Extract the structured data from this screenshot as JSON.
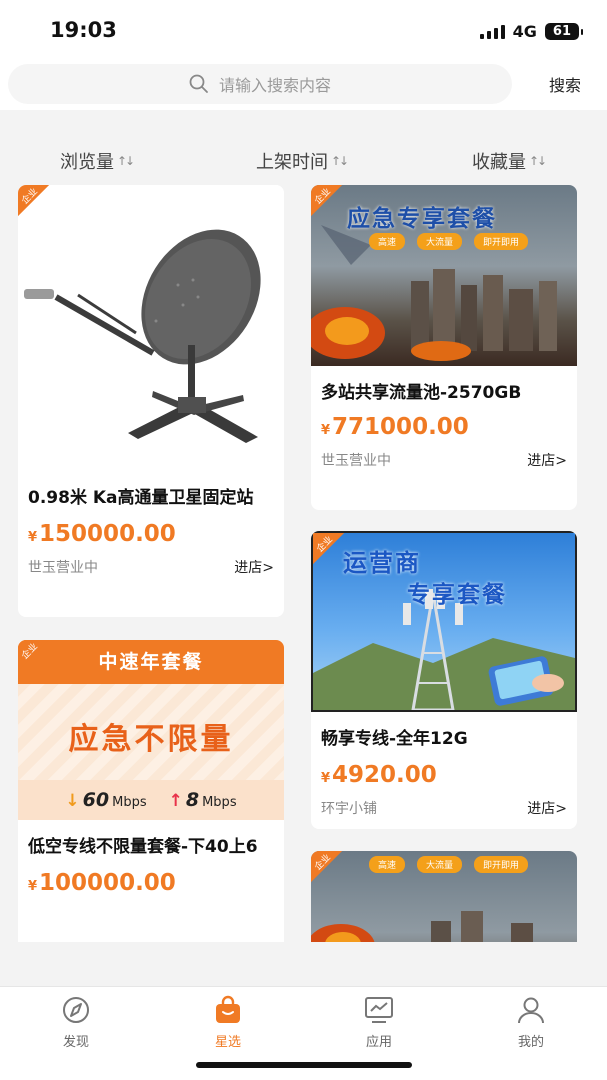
{
  "status": {
    "time": "19:03",
    "network": "4G",
    "battery": "61"
  },
  "search": {
    "placeholder": "请输入搜索内容",
    "button_label": "搜索",
    "icon": "search-icon"
  },
  "sort": [
    {
      "label": "浏览量"
    },
    {
      "label": "上架时间"
    },
    {
      "label": "收藏量"
    }
  ],
  "corner_tag": "企业",
  "products": [
    {
      "title": "0.98米 Ka高通量卫星固定站",
      "currency": "¥",
      "price": "150000.00",
      "shop": "世玉营业中",
      "enter_label": "进店>"
    },
    {
      "title": "多站共享流量池-2570GB",
      "currency": "¥",
      "price": "771000.00",
      "shop": "世玉营业中",
      "enter_label": "进店>",
      "banner": {
        "headline": "应急专享套餐",
        "chips": [
          "高速",
          "大流量",
          "即开即用"
        ]
      }
    },
    {
      "title": "低空专线不限量套餐-下40上6",
      "currency": "¥",
      "price": "100000.00",
      "shop": "",
      "enter_label": "",
      "banner": {
        "header": "中速年套餐",
        "headline": "应急不限量",
        "down_value": "60",
        "up_value": "8",
        "unit": "Mbps"
      }
    },
    {
      "title": "畅享专线-全年12G",
      "currency": "¥",
      "price": "4920.00",
      "shop": "环宇小铺",
      "enter_label": "进店>",
      "banner": {
        "headline_1": "运营商",
        "headline_2": "专享套餐"
      }
    },
    {
      "banner": {
        "chips": [
          "高速",
          "大流量",
          "即开即用"
        ]
      }
    }
  ],
  "tabs": [
    {
      "label": "发现",
      "icon": "compass-icon",
      "active": false
    },
    {
      "label": "星选",
      "icon": "shopping-bag-icon",
      "active": true
    },
    {
      "label": "应用",
      "icon": "monitor-chart-icon",
      "active": false
    },
    {
      "label": "我的",
      "icon": "user-icon",
      "active": false
    }
  ],
  "colors": {
    "accent": "#f07a24",
    "background": "#f3f3f3"
  }
}
